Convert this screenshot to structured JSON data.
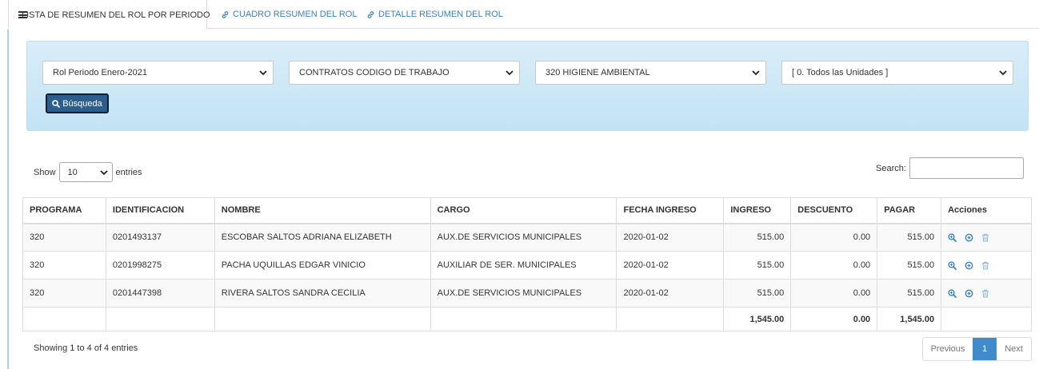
{
  "tabs": [
    {
      "label": "LISTA DE RESUMEN DEL ROL POR PERIODO"
    },
    {
      "label": "CUADRO RESUMEN DEL ROL"
    },
    {
      "label": "DETALLE RESUMEN DEL ROL"
    }
  ],
  "filters": {
    "periodo": "Rol Periodo Enero-2021",
    "contrato": "CONTRATOS CODIGO DE TRABAJO",
    "programa": "320 HIGIENE AMBIENTAL",
    "unidad": "[ 0. Todos las Unidades ]",
    "search_button": "Búsqueda"
  },
  "length": {
    "show": "Show",
    "value": "10",
    "entries": "entries"
  },
  "search": {
    "label": "Search:",
    "value": ""
  },
  "table": {
    "headers": [
      "PROGRAMA",
      "IDENTIFICACION",
      "NOMBRE",
      "CARGO",
      "FECHA INGRESO",
      "INGRESO",
      "DESCUENTO",
      "PAGAR",
      "Acciones"
    ],
    "rows": [
      [
        "320",
        "0201493137",
        "ESCOBAR SALTOS ADRIANA ELIZABETH",
        "AUX.DE SERVICIOS MUNICIPALES",
        "2020-01-02",
        "515.00",
        "0.00",
        "515.00"
      ],
      [
        "320",
        "0201998275",
        "PACHA UQUILLAS EDGAR VINICIO",
        "AUXILIAR DE SER. MUNICIPALES",
        "2020-01-02",
        "515.00",
        "0.00",
        "515.00"
      ],
      [
        "320",
        "0201447398",
        "RIVERA SALTOS SANDRA CECILIA",
        "AUX.DE SERVICIOS MUNICIPALES",
        "2020-01-02",
        "515.00",
        "0.00",
        "515.00"
      ]
    ],
    "totals": {
      "ingreso": "1,545.00",
      "descuento": "0.00",
      "pagar": "1,545.00"
    }
  },
  "info": "Showing 1 to 4 of 4 entries",
  "pagination": {
    "previous": "Previous",
    "current": "1",
    "next": "Next"
  },
  "icons": {
    "view": "zoom-in-icon",
    "add": "plus-circle-icon",
    "delete": "trash-icon",
    "accent": "#3c7fc2"
  }
}
